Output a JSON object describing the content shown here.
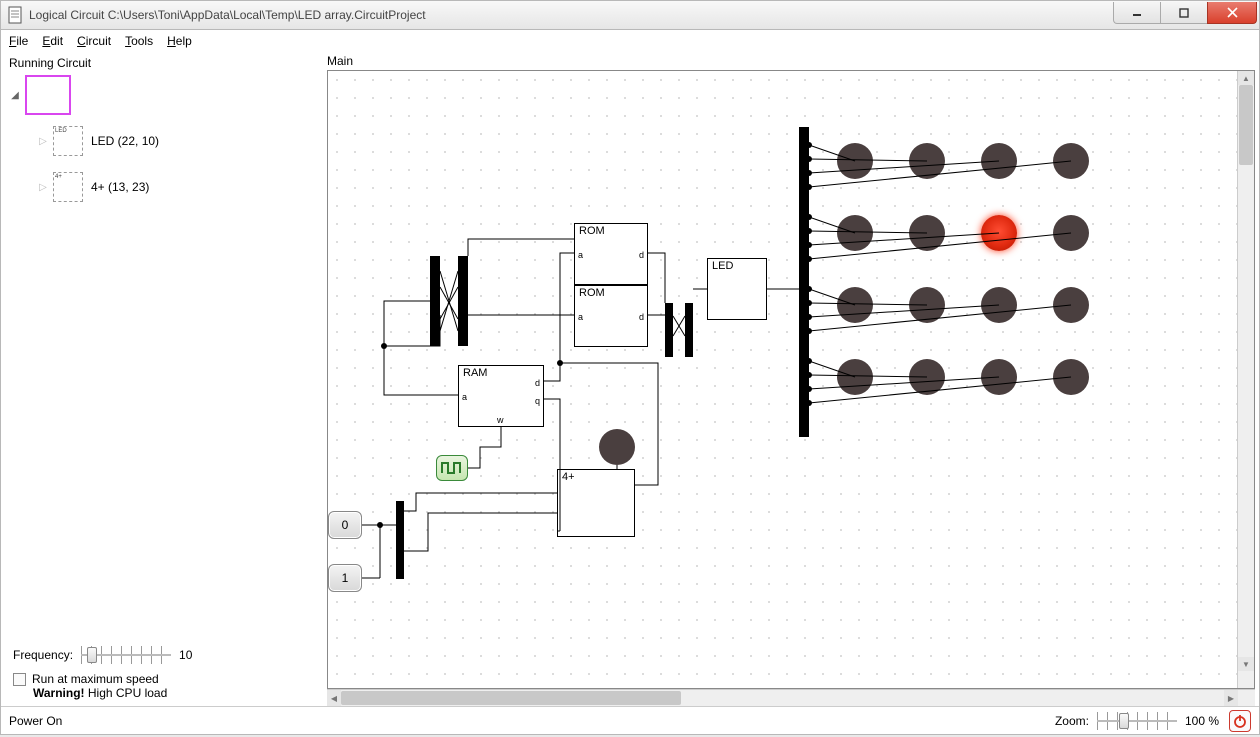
{
  "window": {
    "title": "Logical Circuit C:\\Users\\Toni\\AppData\\Local\\Temp\\LED array.CircuitProject"
  },
  "menu": {
    "file": "File",
    "edit": "Edit",
    "circuit": "Circuit",
    "tools": "Tools",
    "help": "Help"
  },
  "sidebar": {
    "title": "Running Circuit",
    "items": [
      {
        "label": ""
      },
      {
        "label": "LED  (22, 10)",
        "thumb": "LED"
      },
      {
        "label": "4+  (13, 23)",
        "thumb": "4+"
      }
    ],
    "frequency_label": "Frequency:",
    "frequency_value": "10",
    "max_speed_label": "Run at maximum speed",
    "warning_bold": "Warning!",
    "warning_rest": " High CPU load"
  },
  "canvas": {
    "title": "Main",
    "components": {
      "rom1": "ROM",
      "rom2": "ROM",
      "ram": "RAM",
      "led": "LED",
      "fourplus": "4+",
      "btn0": "0",
      "btn1": "1"
    },
    "port_labels": {
      "a": "a",
      "d": "d",
      "q": "q",
      "w": "w"
    }
  },
  "status": {
    "power": "Power On",
    "zoom_label": "Zoom:",
    "zoom_value": "100 %"
  },
  "colors": {
    "led_off": "#4a3f3f",
    "led_on": "#e02a10",
    "accent": "#d946ef"
  }
}
